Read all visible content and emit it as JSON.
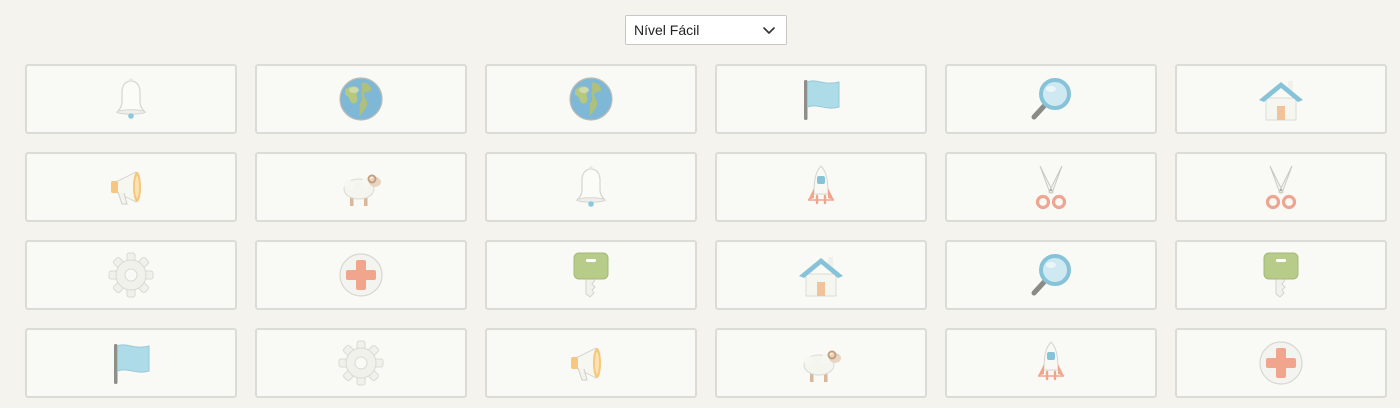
{
  "level_select": {
    "value": "Nível Fácil"
  },
  "cards": [
    {
      "icon": "bell-icon"
    },
    {
      "icon": "globe-icon"
    },
    {
      "icon": "globe-icon"
    },
    {
      "icon": "flag-icon"
    },
    {
      "icon": "magnifier-icon"
    },
    {
      "icon": "house-icon"
    },
    {
      "icon": "megaphone-icon"
    },
    {
      "icon": "sheep-icon"
    },
    {
      "icon": "bell-icon"
    },
    {
      "icon": "rocket-icon"
    },
    {
      "icon": "scissors-icon"
    },
    {
      "icon": "scissors-icon"
    },
    {
      "icon": "gear-icon"
    },
    {
      "icon": "plus-icon"
    },
    {
      "icon": "key-icon"
    },
    {
      "icon": "house-icon"
    },
    {
      "icon": "magnifier-icon"
    },
    {
      "icon": "key-icon"
    },
    {
      "icon": "flag-icon"
    },
    {
      "icon": "gear-icon"
    },
    {
      "icon": "megaphone-icon"
    },
    {
      "icon": "sheep-icon"
    },
    {
      "icon": "rocket-icon"
    },
    {
      "icon": "plus-icon"
    }
  ]
}
